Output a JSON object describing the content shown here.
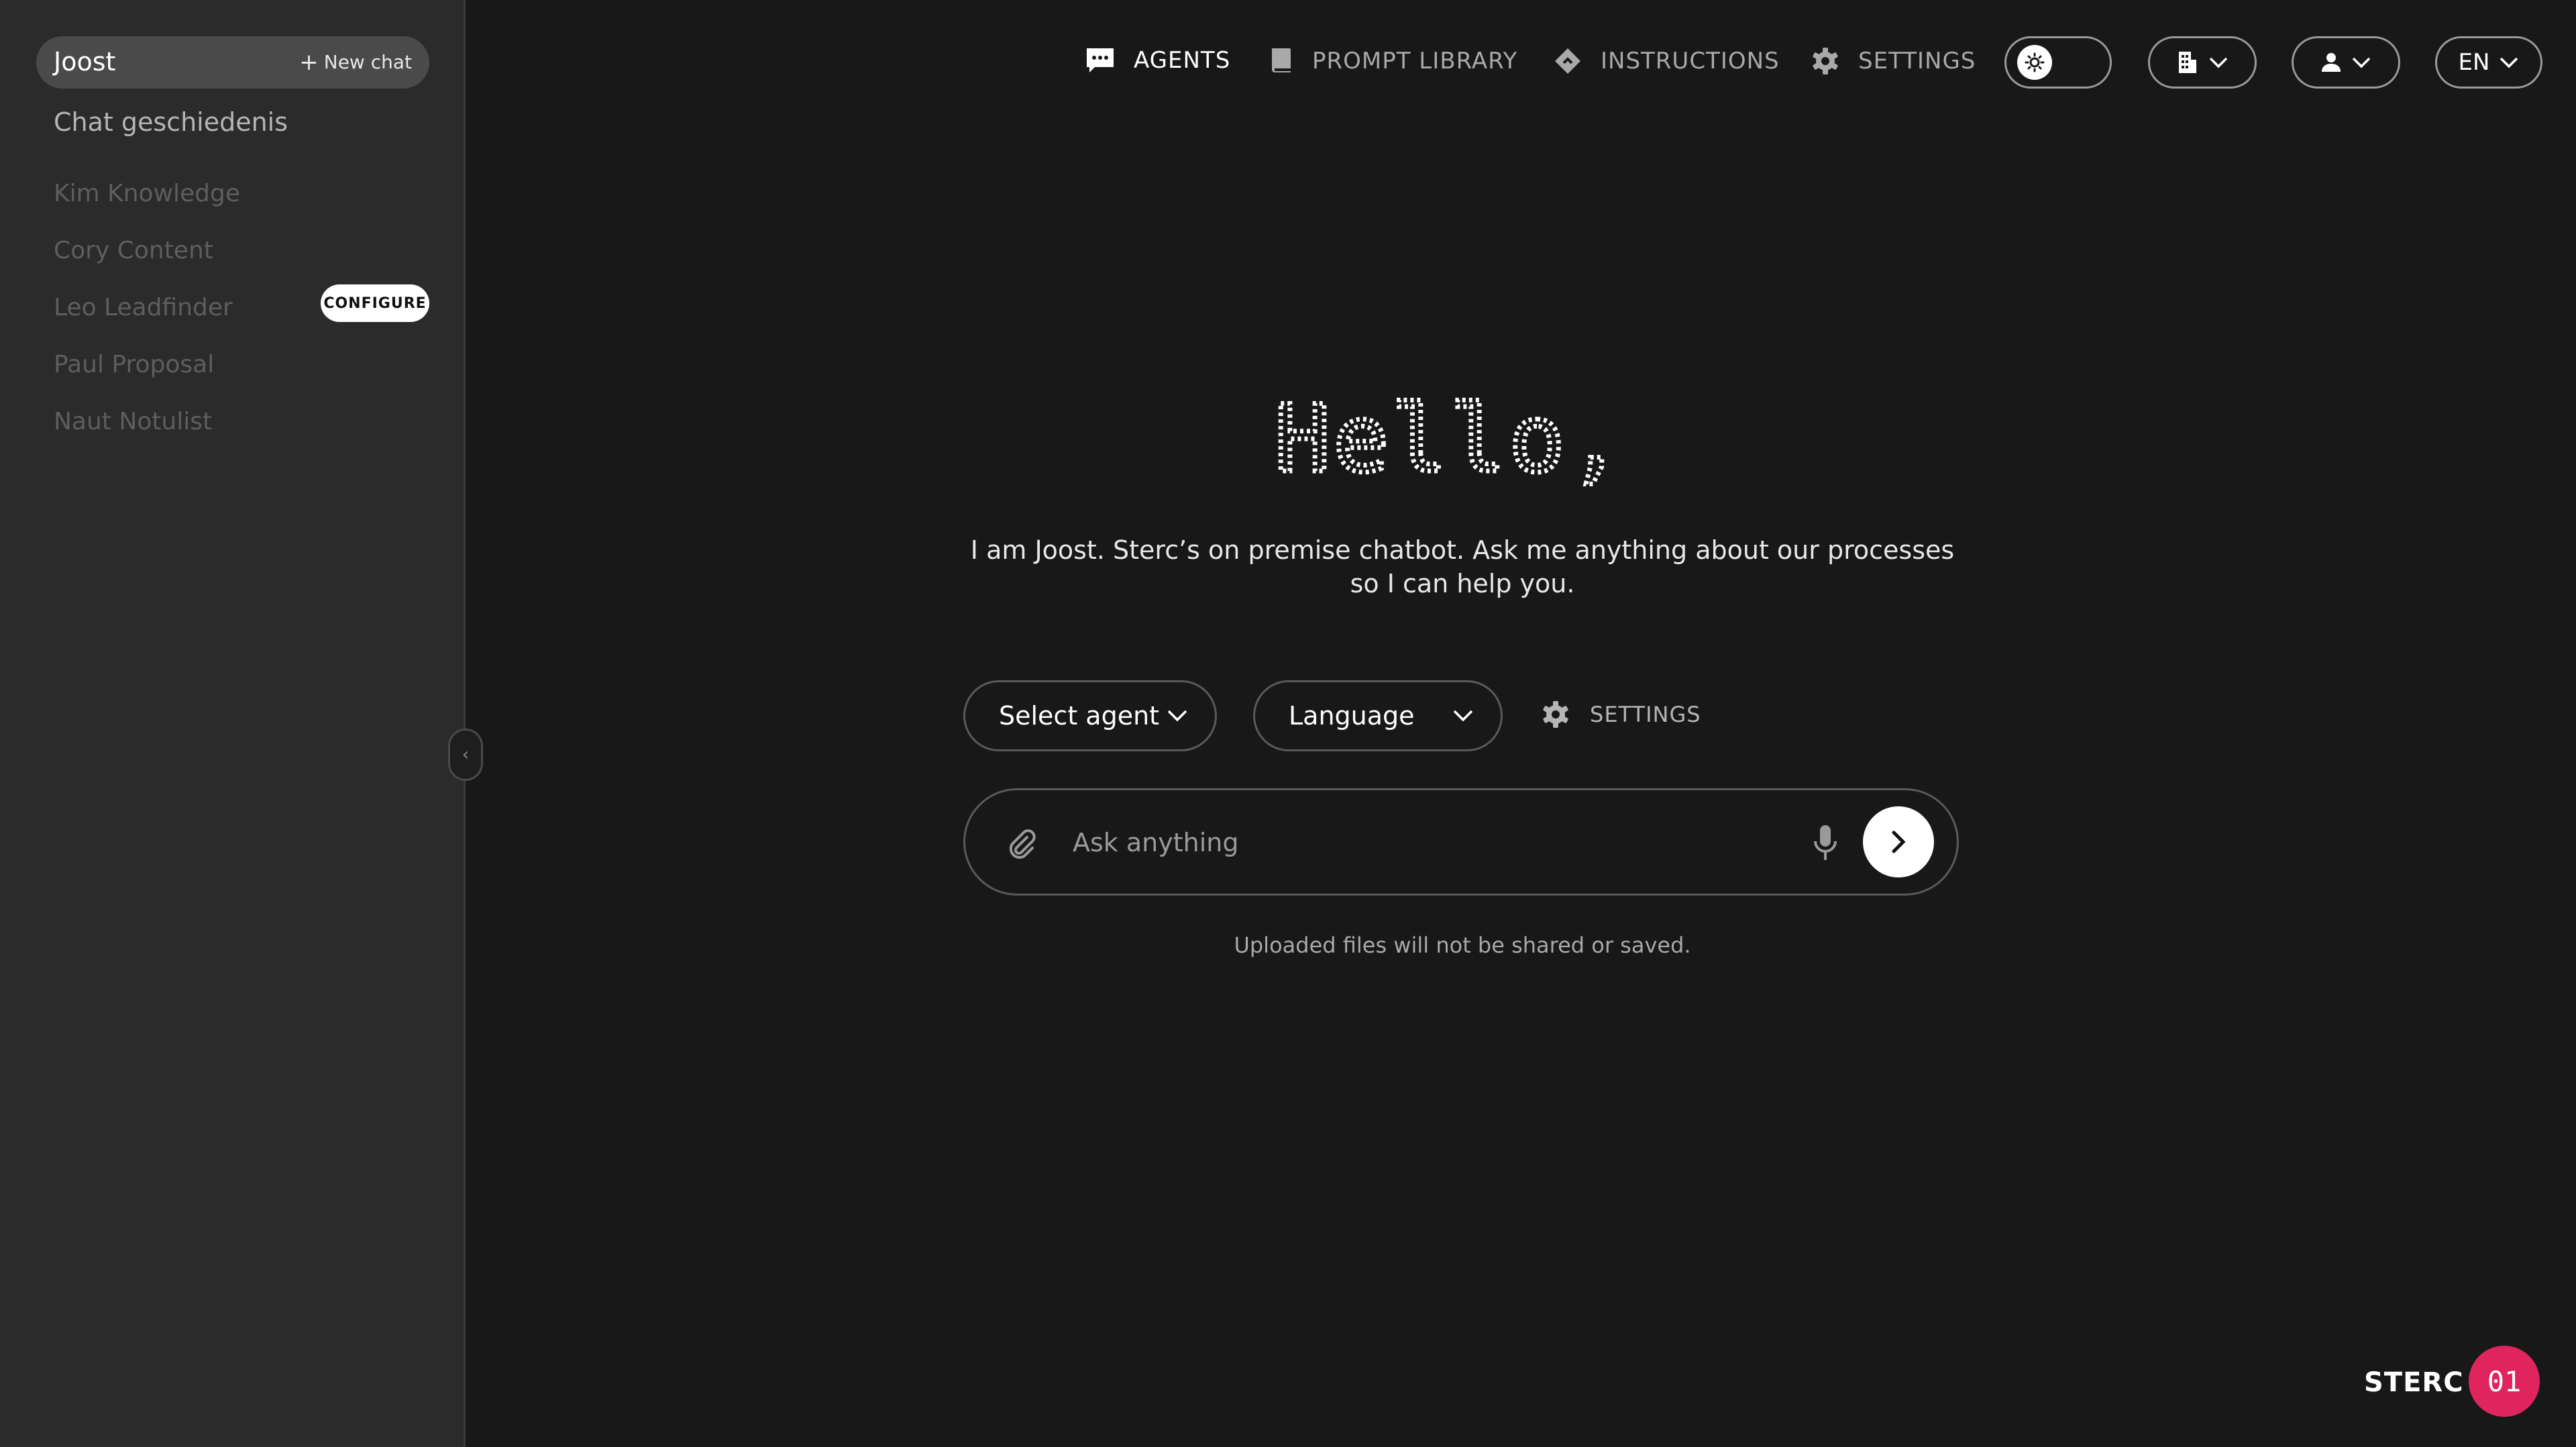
{
  "sidebar": {
    "active_chat": "Joost",
    "new_chat_label": "New chat",
    "history_label": "Chat geschiedenis",
    "agents": [
      {
        "label": "Kim Knowledge"
      },
      {
        "label": "Cory Content"
      },
      {
        "label": "Leo Leadfinder"
      },
      {
        "label": "Paul Proposal"
      },
      {
        "label": "Naut Notulist"
      }
    ],
    "configure_label": "CONFIGURE"
  },
  "nav": {
    "agents": "AGENTS",
    "prompt_library": "PROMPT LIBRARY",
    "instructions": "INSTRUCTIONS",
    "settings": "SETTINGS",
    "language": "EN"
  },
  "main": {
    "greeting": "Hello,",
    "subtitle_line1": "I am Joost. Sterc’s on premise chatbot. Ask me anything about our processes",
    "subtitle_line2": "so I can help you.",
    "select_agent": "Select agent",
    "language": "Language",
    "settings_label": "SETTINGS",
    "input_placeholder": "Ask anything",
    "disclaimer": "Uploaded files will not be shared or saved."
  },
  "brand": {
    "name": "STERC",
    "badge": "01",
    "accent_color": "#e0245e"
  },
  "icons": [
    "chat-icon",
    "book-icon",
    "diamond-icon",
    "gear-icon",
    "sun-icon",
    "building-icon",
    "user-icon",
    "chevron-down-icon",
    "paperclip-icon",
    "microphone-icon",
    "arrow-right-icon",
    "chevron-left-icon",
    "plus-icon"
  ]
}
